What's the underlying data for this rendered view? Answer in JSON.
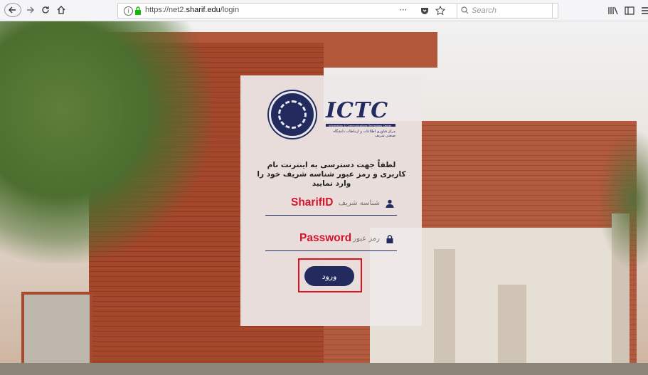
{
  "browser": {
    "back_icon": "back-arrow-icon",
    "url_prefix": "https://net2.",
    "url_domain": "sharif.edu",
    "url_path": "/login",
    "search_placeholder": "Search",
    "menu_dots": "···"
  },
  "login": {
    "logo_text": "ICTC",
    "logo_english_sub": "Information & Communications Technology Center",
    "logo_persian_sub": "مرکز فناوری اطلاعات و ارتباطات دانشگاه صنعتی شریف",
    "instruction": "لطفاً جهت دسترسی به اینترنت نام کاربری و رمز عبور شناسه شریف خود را وارد نمایید",
    "username_placeholder": "شناسه شریف",
    "username_annotation": "SharifID",
    "password_placeholder": "رمز عبور",
    "password_annotation": "Password",
    "submit_label": "ورود"
  },
  "colors": {
    "accent": "#232a5e",
    "annotation": "#d4142a",
    "highlight": "#e0101e"
  }
}
